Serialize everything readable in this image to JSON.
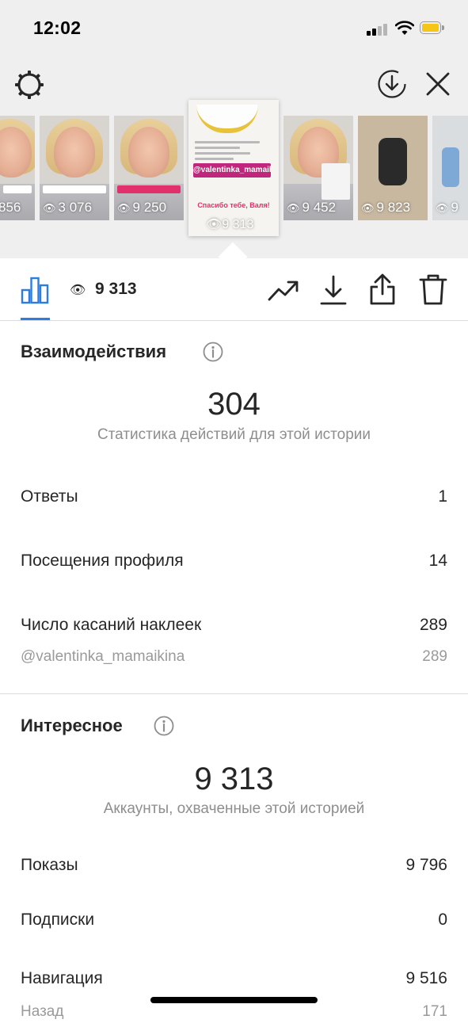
{
  "status_bar": {
    "time": "12:02"
  },
  "thumbnails": [
    {
      "views": "856",
      "tag": "white"
    },
    {
      "views": "3 076",
      "tag": "white"
    },
    {
      "views": "9 250",
      "tag": "pink"
    },
    {
      "views": "9 313",
      "selected": true,
      "sticker": "@valentinka_mamaikina",
      "caption": "Спасибо тебе, Валя!"
    },
    {
      "views": "9 452",
      "tag": "none"
    },
    {
      "views": "9 823",
      "tag": "none"
    },
    {
      "views": "9",
      "tag": "none"
    }
  ],
  "toolbar": {
    "views": "9 313"
  },
  "interactions": {
    "title": "Взаимодействия",
    "total": "304",
    "subtitle": "Статистика действий для этой истории",
    "rows": [
      {
        "label": "Ответы",
        "value": "1"
      },
      {
        "label": "Посещения профиля",
        "value": "14"
      },
      {
        "label": "Число касаний наклеек",
        "value": "289"
      },
      {
        "label": "@valentinka_mamaikina",
        "value": "289"
      }
    ]
  },
  "discovery": {
    "title": "Интересное",
    "total": "9 313",
    "subtitle": "Аккаунты, охваченные этой историей",
    "rows": [
      {
        "label": "Показы",
        "value": "9 796"
      },
      {
        "label": "Подписки",
        "value": "0"
      },
      {
        "label": "Навигация",
        "value": "9 516"
      },
      {
        "label": "Назад",
        "value": "171"
      }
    ]
  },
  "colors": {
    "accent": "#2d7de0",
    "battery": "#f5c518",
    "story_tag": "#c0267c"
  }
}
